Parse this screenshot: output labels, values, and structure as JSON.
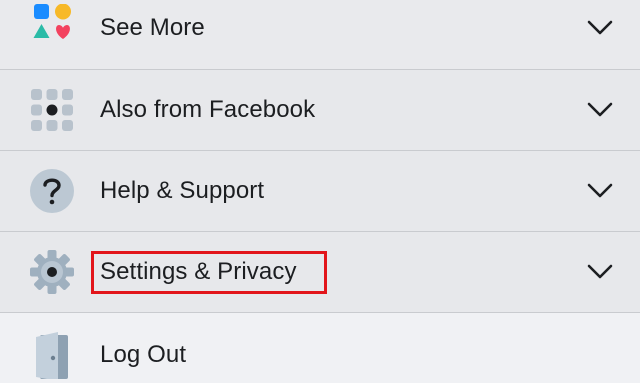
{
  "menu": {
    "items": [
      {
        "label": "See More",
        "icon": "shapes-icon",
        "expandable": true
      },
      {
        "label": "Also from Facebook",
        "icon": "app-grid-icon",
        "expandable": true
      },
      {
        "label": "Help & Support",
        "icon": "question-mark-icon",
        "expandable": true
      },
      {
        "label": "Settings & Privacy",
        "icon": "gear-icon",
        "expandable": true,
        "highlighted": true
      },
      {
        "label": "Log Out",
        "icon": "door-icon",
        "expandable": false
      }
    ]
  },
  "colors": {
    "background": "#f0f1f4",
    "row": "#e7e8eb",
    "text": "#1c1e21",
    "highlight_border": "#e2151b"
  }
}
